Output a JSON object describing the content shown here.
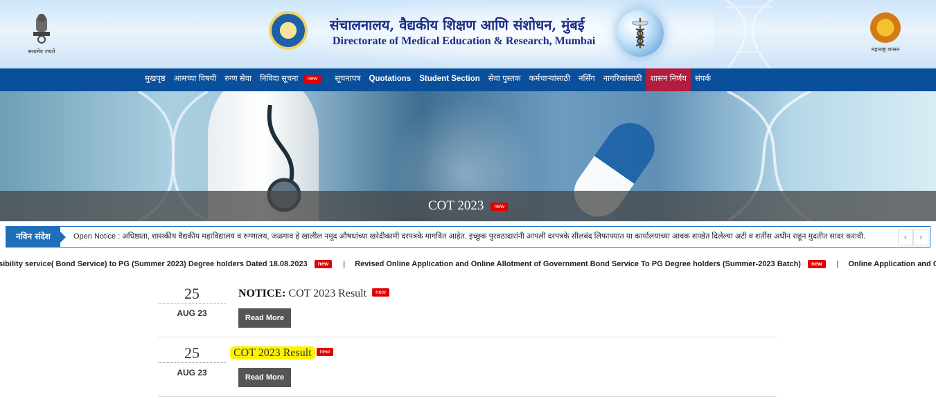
{
  "header": {
    "title_marathi": "संचालनालय, वैद्यकीय शिक्षण आणि संशोधन, मुंबई",
    "title_english": "Directorate of Medical Education & Research, Mumbai",
    "left_emblem_caption": "सत्यमेव जयते",
    "right_emblem_caption": "महाराष्ट्र शासन"
  },
  "nav": {
    "items": [
      {
        "label": "मुखपृष्ठ"
      },
      {
        "label": "आमच्या विषयी"
      },
      {
        "label": "रुग्ण सेवा"
      },
      {
        "label": "निविदा सूचना",
        "badge": "new"
      },
      {
        "label": "सूचनापत्र"
      },
      {
        "label": "Quotations"
      },
      {
        "label": "Student Section"
      },
      {
        "label": "सेवा पुस्तक"
      },
      {
        "label": "कर्मचाऱ्यांसाठी"
      },
      {
        "label": "नर्सिंग"
      },
      {
        "label": "नागरिकांसाठी"
      },
      {
        "label": "शासन निर्णय"
      },
      {
        "label": "संपर्क"
      }
    ]
  },
  "banner": {
    "caption": "COT 2023",
    "badge": "new"
  },
  "notice": {
    "label": "नविन संदेश",
    "text": "Open Notice : अधिष्ठाता, शासकीय वैद्यकीय महाविद्यालय व रुग्णालय, जळगाव हे खालील नमूद औषधांच्या खरेदीकामी दरपत्रके मागवित आहेत. इच्छुक पुरवठादारांनी आपली दरपत्रके सीलबंद लिफाफ्यात या कार्यालयाच्या आवक शाखेत दिलेल्या अटी व शर्तीस अधीन राहून मुदतीत सादर करावी.",
    "prev": "‹",
    "next": "›"
  },
  "marquee": {
    "item1": "sibility service( Bond Service) to PG (Summer 2023) Degree holders Dated 18.08.2023",
    "item2": "Revised Online Application and Online Allotment of Government Bond Service To PG Degree holders (Summer-2023 Batch)",
    "item3": "Online Application and Online Allotm",
    "separator": "|",
    "badge": "new"
  },
  "news": [
    {
      "day": "25",
      "month": "AUG 23",
      "title_bold": "NOTICE:",
      "title": "COT 2023 Result",
      "badge": "new",
      "button": "Read More"
    },
    {
      "day": "25",
      "month": "AUG 23",
      "title": "COT 2023 Result",
      "badge": "new",
      "button": "Read More"
    }
  ]
}
